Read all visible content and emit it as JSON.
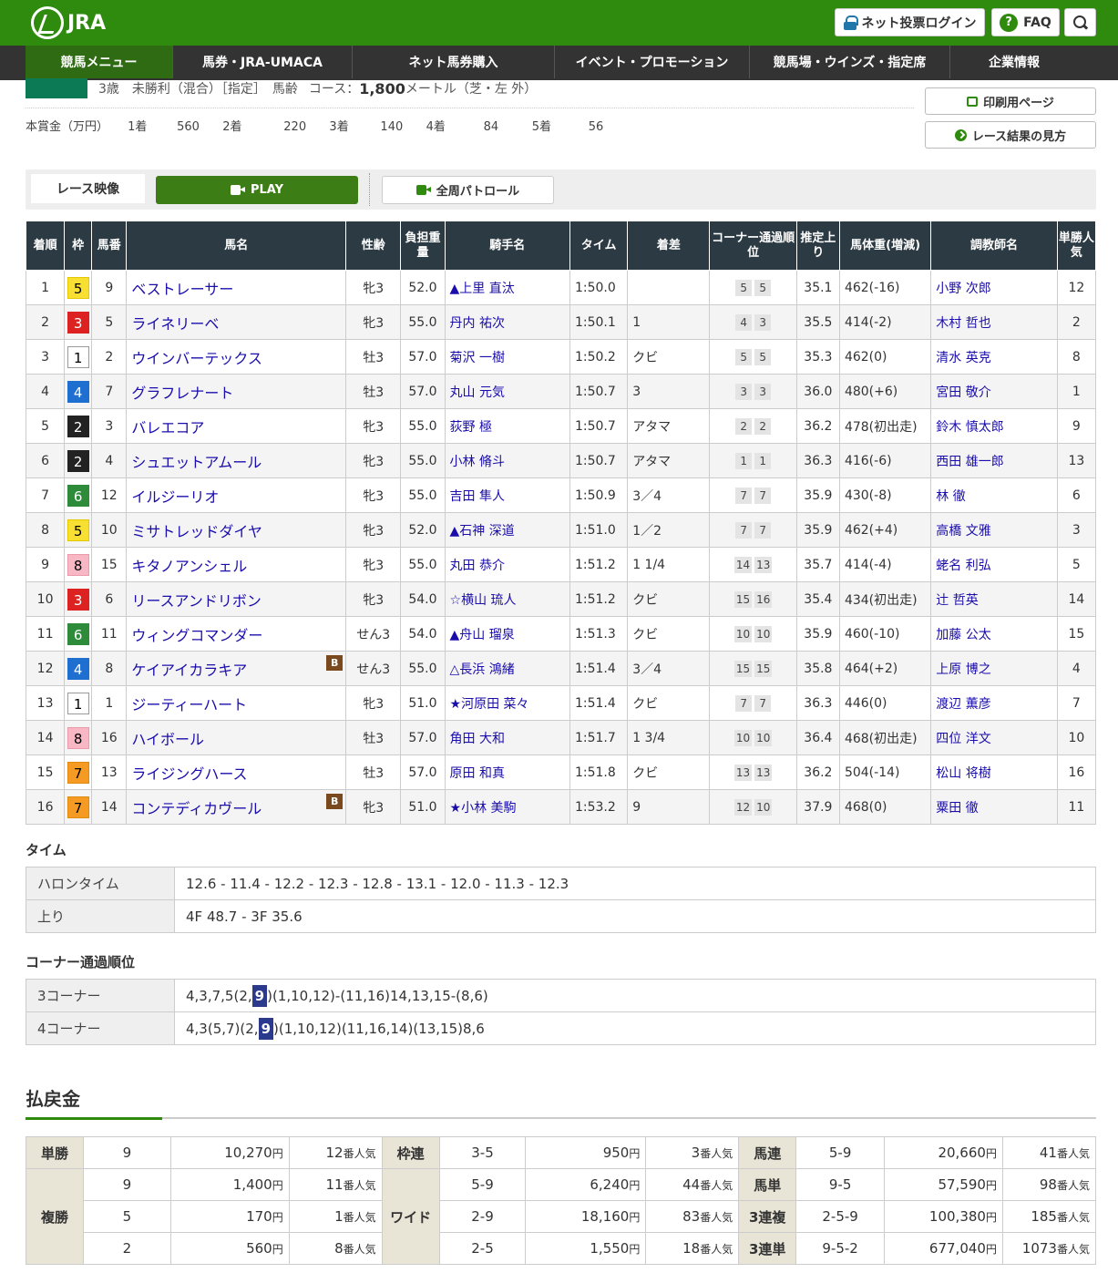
{
  "header": {
    "logo_text": "JRA",
    "login_label": "ネット投票ログイン",
    "faq_label": "FAQ",
    "faq_icon_glyph": "?"
  },
  "nav": [
    "競馬メニュー",
    "馬券・JRA-UMACA",
    "ネット馬券購入",
    "イベント・プロモーション",
    "競馬場・ウインズ・指定席",
    "企業情報"
  ],
  "race_info": {
    "conditions": "3歳　未勝利（混合）［指定］　馬齢",
    "course_label": "コース：",
    "distance": "1,800",
    "distance_unit": "メートル（芝・左 外）"
  },
  "prize": {
    "label": "本賞金（万円）",
    "items": [
      {
        "rank": "1着",
        "value": "560"
      },
      {
        "rank": "2着",
        "value": "220"
      },
      {
        "rank": "3着",
        "value": "140"
      },
      {
        "rank": "4着",
        "value": "84"
      },
      {
        "rank": "5着",
        "value": "56"
      }
    ]
  },
  "side_buttons": {
    "print": "印刷用ページ",
    "guide": "レース結果の見方"
  },
  "video": {
    "label": "レース映像",
    "play": "PLAY",
    "patrol": "全周パトロール"
  },
  "results": {
    "headers": [
      "着順",
      "枠",
      "馬番",
      "馬名",
      "性齢",
      "負担重量",
      "騎手名",
      "タイム",
      "着差",
      "コーナー通過順位",
      "推定上り",
      "馬体重(増減)",
      "調教師名",
      "単勝人気"
    ],
    "rows": [
      {
        "pos": "1",
        "waku": "5",
        "num": "9",
        "horse": "ベストレーサー",
        "blinker": false,
        "sex": "牝3",
        "wt": "52.0",
        "jockey": "▲上里 直汰",
        "time": "1:50.0",
        "margin": "",
        "c3": "5",
        "c4": "5",
        "last": "35.1",
        "bw": "462(-16)",
        "trainer": "小野 次郎",
        "pop": "12"
      },
      {
        "pos": "2",
        "waku": "3",
        "num": "5",
        "horse": "ライネリーベ",
        "blinker": false,
        "sex": "牝3",
        "wt": "55.0",
        "jockey": "丹内 祐次",
        "time": "1:50.1",
        "margin": "1",
        "c3": "4",
        "c4": "3",
        "last": "35.5",
        "bw": "414(-2)",
        "trainer": "木村 哲也",
        "pop": "2"
      },
      {
        "pos": "3",
        "waku": "1",
        "num": "2",
        "horse": "ウインバーテックス",
        "blinker": false,
        "sex": "牡3",
        "wt": "57.0",
        "jockey": "菊沢 一樹",
        "time": "1:50.2",
        "margin": "クビ",
        "c3": "5",
        "c4": "5",
        "last": "35.3",
        "bw": "462(0)",
        "trainer": "清水 英克",
        "pop": "8"
      },
      {
        "pos": "4",
        "waku": "4",
        "num": "7",
        "horse": "グラフレナート",
        "blinker": false,
        "sex": "牡3",
        "wt": "57.0",
        "jockey": "丸山 元気",
        "time": "1:50.7",
        "margin": "3",
        "c3": "3",
        "c4": "3",
        "last": "36.0",
        "bw": "480(+6)",
        "trainer": "宮田 敬介",
        "pop": "1"
      },
      {
        "pos": "5",
        "waku": "2",
        "num": "3",
        "horse": "バレエコア",
        "blinker": false,
        "sex": "牝3",
        "wt": "55.0",
        "jockey": "荻野 極",
        "time": "1:50.7",
        "margin": "アタマ",
        "c3": "2",
        "c4": "2",
        "last": "36.2",
        "bw": "478(初出走)",
        "trainer": "鈴木 慎太郎",
        "pop": "9"
      },
      {
        "pos": "6",
        "waku": "2",
        "num": "4",
        "horse": "シュエットアムール",
        "blinker": false,
        "sex": "牝3",
        "wt": "55.0",
        "jockey": "小林 脩斗",
        "time": "1:50.7",
        "margin": "アタマ",
        "c3": "1",
        "c4": "1",
        "last": "36.3",
        "bw": "416(-6)",
        "trainer": "西田 雄一郎",
        "pop": "13"
      },
      {
        "pos": "7",
        "waku": "6",
        "num": "12",
        "horse": "イルジーリオ",
        "blinker": false,
        "sex": "牝3",
        "wt": "55.0",
        "jockey": "吉田 隼人",
        "time": "1:50.9",
        "margin": "3／4",
        "c3": "7",
        "c4": "7",
        "last": "35.9",
        "bw": "430(-8)",
        "trainer": "林 徹",
        "pop": "6"
      },
      {
        "pos": "8",
        "waku": "5",
        "num": "10",
        "horse": "ミサトレッドダイヤ",
        "blinker": false,
        "sex": "牝3",
        "wt": "52.0",
        "jockey": "▲石神 深道",
        "time": "1:51.0",
        "margin": "1／2",
        "c3": "7",
        "c4": "7",
        "last": "35.9",
        "bw": "462(+4)",
        "trainer": "高橋 文雅",
        "pop": "3"
      },
      {
        "pos": "9",
        "waku": "8",
        "num": "15",
        "horse": "キタノアンシェル",
        "blinker": false,
        "sex": "牝3",
        "wt": "55.0",
        "jockey": "丸田 恭介",
        "time": "1:51.2",
        "margin": "1 1/4",
        "c3": "14",
        "c4": "13",
        "last": "35.7",
        "bw": "414(-4)",
        "trainer": "蛯名 利弘",
        "pop": "5"
      },
      {
        "pos": "10",
        "waku": "3",
        "num": "6",
        "horse": "リースアンドリボン",
        "blinker": false,
        "sex": "牝3",
        "wt": "54.0",
        "jockey": "☆横山 琉人",
        "time": "1:51.2",
        "margin": "クビ",
        "c3": "15",
        "c4": "16",
        "last": "35.4",
        "bw": "434(初出走)",
        "trainer": "辻 哲英",
        "pop": "14"
      },
      {
        "pos": "11",
        "waku": "6",
        "num": "11",
        "horse": "ウィングコマンダー",
        "blinker": false,
        "sex": "せん3",
        "wt": "54.0",
        "jockey": "▲舟山 瑠泉",
        "time": "1:51.3",
        "margin": "クビ",
        "c3": "10",
        "c4": "10",
        "last": "35.9",
        "bw": "460(-10)",
        "trainer": "加藤 公太",
        "pop": "15"
      },
      {
        "pos": "12",
        "waku": "4",
        "num": "8",
        "horse": "ケイアイカラキア",
        "blinker": true,
        "sex": "せん3",
        "wt": "55.0",
        "jockey": "△長浜 鴻緒",
        "time": "1:51.4",
        "margin": "3／4",
        "c3": "15",
        "c4": "15",
        "last": "35.8",
        "bw": "464(+2)",
        "trainer": "上原 博之",
        "pop": "4"
      },
      {
        "pos": "13",
        "waku": "1",
        "num": "1",
        "horse": "ジーティーハート",
        "blinker": false,
        "sex": "牝3",
        "wt": "51.0",
        "jockey": "★河原田 菜々",
        "time": "1:51.4",
        "margin": "クビ",
        "c3": "7",
        "c4": "7",
        "last": "36.3",
        "bw": "446(0)",
        "trainer": "渡辺 薫彦",
        "pop": "7"
      },
      {
        "pos": "14",
        "waku": "8",
        "num": "16",
        "horse": "ハイボール",
        "blinker": false,
        "sex": "牡3",
        "wt": "57.0",
        "jockey": "角田 大和",
        "time": "1:51.7",
        "margin": "1 3/4",
        "c3": "10",
        "c4": "10",
        "last": "36.4",
        "bw": "468(初出走)",
        "trainer": "四位 洋文",
        "pop": "10"
      },
      {
        "pos": "15",
        "waku": "7",
        "num": "13",
        "horse": "ライジングハース",
        "blinker": false,
        "sex": "牡3",
        "wt": "57.0",
        "jockey": "原田 和真",
        "time": "1:51.8",
        "margin": "クビ",
        "c3": "13",
        "c4": "13",
        "last": "36.2",
        "bw": "504(-14)",
        "trainer": "松山 将樹",
        "pop": "16"
      },
      {
        "pos": "16",
        "waku": "7",
        "num": "14",
        "horse": "コンテディカヴール",
        "blinker": true,
        "sex": "牝3",
        "wt": "51.0",
        "jockey": "★小林 美駒",
        "time": "1:53.2",
        "margin": "9",
        "c3": "12",
        "c4": "10",
        "last": "37.9",
        "bw": "468(0)",
        "trainer": "粟田 徹",
        "pop": "11"
      }
    ],
    "blinker_label": "B"
  },
  "time_section": {
    "title": "タイム",
    "rows": [
      {
        "label": "ハロンタイム",
        "value": "12.6 - 11.4 - 12.2 - 12.3 - 12.8 - 13.1 - 12.0 - 11.3 - 12.3"
      },
      {
        "label": "上り",
        "value": "4F 48.7 - 3F 35.6"
      }
    ]
  },
  "corner_section": {
    "title": "コーナー通過順位",
    "rows": [
      {
        "label": "3コーナー",
        "pre": "4,3,7,5(2,",
        "hl": "9",
        "post": ")(1,10,12)-(11,16)14,13,15-(8,6)"
      },
      {
        "label": "4コーナー",
        "pre": "4,3(5,7)(2,",
        "hl": "9",
        "post": ")(1,10,12)(11,16,14)(13,15)8,6"
      }
    ]
  },
  "payout": {
    "title": "払戻金",
    "yen": "円",
    "nin": "番人気",
    "tansho": {
      "label": "単勝",
      "num": "9",
      "amt": "10,270",
      "pop": "12"
    },
    "fukusho": {
      "label": "複勝",
      "rows": [
        {
          "num": "9",
          "amt": "1,400",
          "pop": "11"
        },
        {
          "num": "5",
          "amt": "170",
          "pop": "1"
        },
        {
          "num": "2",
          "amt": "560",
          "pop": "8"
        }
      ]
    },
    "wakuren": {
      "label": "枠連",
      "num": "3-5",
      "amt": "950",
      "pop": "3"
    },
    "wide": {
      "label": "ワイド",
      "rows": [
        {
          "num": "5-9",
          "amt": "6,240",
          "pop": "44"
        },
        {
          "num": "2-9",
          "amt": "18,160",
          "pop": "83"
        },
        {
          "num": "2-5",
          "amt": "1,550",
          "pop": "18"
        }
      ]
    },
    "right": [
      {
        "label": "馬連",
        "num": "5-9",
        "amt": "20,660",
        "pop": "41"
      },
      {
        "label": "馬単",
        "num": "9-5",
        "amt": "57,590",
        "pop": "98"
      },
      {
        "label": "3連複",
        "num": "2-5-9",
        "amt": "100,380",
        "pop": "185"
      },
      {
        "label": "3連単",
        "num": "9-5-2",
        "amt": "677,040",
        "pop": "1073"
      }
    ]
  }
}
